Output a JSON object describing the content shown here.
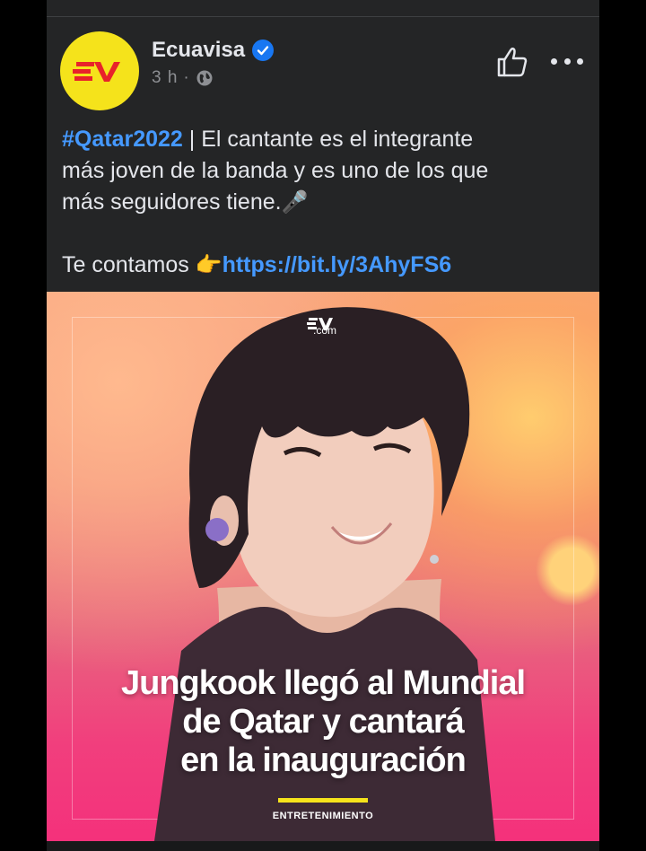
{
  "post": {
    "author": "Ecuavisa",
    "time": "3 h",
    "separator": "·",
    "hashtag": "#Qatar2022",
    "text_line1": " | El cantante es el integrante",
    "text_line2": "más joven de la banda y es uno de los que",
    "text_line3": "más seguidores tiene.",
    "mic_emoji": "🎤",
    "cta_text": "Te contamos ",
    "point_emoji": "👉",
    "link": "https://bit.ly/3AhyFS6",
    "avatar_logo": "EV",
    "verified_icon": "check-badge-icon",
    "privacy_icon": "globe-icon"
  },
  "image": {
    "watermark_sub": ".com",
    "headline_line1": "Jungkook llegó al Mundial",
    "headline_line2": "de Qatar y cantará",
    "headline_line3": "en la inauguración",
    "category": "ENTRETENIMIENTO"
  },
  "colors": {
    "background": "#242526",
    "link": "#4599ff",
    "verified": "#1877f2",
    "avatar": "#f5e31b",
    "accent_bar": "#f5e31b",
    "image_bottom": "#f4317b"
  }
}
